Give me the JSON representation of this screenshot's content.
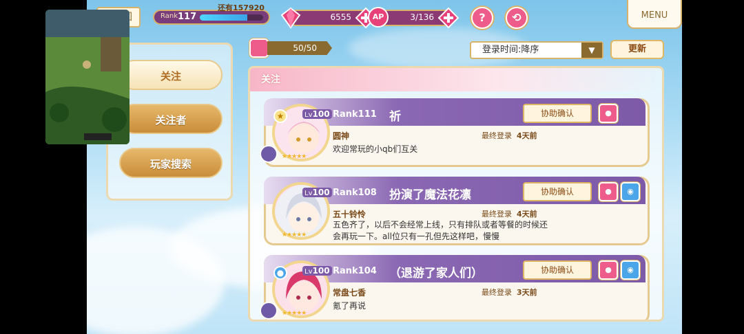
{
  "topbar": {
    "back_label": "回",
    "rank_label": "Rank",
    "rank_value": "117",
    "rank_remaining": "还有157920",
    "rank_progress": 0.75,
    "gems_value": "6555",
    "ap_label": "AP",
    "ap_value": "3/136",
    "help_label": "?",
    "menu_label": "MENU"
  },
  "sidebar": {
    "items": [
      {
        "label": "关注"
      },
      {
        "label": "关注者"
      },
      {
        "label": "玩家搜索"
      }
    ]
  },
  "toolbar": {
    "count": "50/50",
    "sort_value": "登录时间:降序",
    "refresh_label": "更新"
  },
  "list": {
    "header": "关注",
    "assist_label": "协助确认",
    "lv_prefix": "Lv",
    "last_login_prefix": "最终登录",
    "rows": [
      {
        "lv": "100",
        "rank": "Rank111",
        "player_name": "祈",
        "char_name": "圆神",
        "last_login": "4天前",
        "comment": "欢迎常玩的小qb们互关",
        "badge": "★",
        "has_blue_icon": false
      },
      {
        "lv": "100",
        "rank": "Rank108",
        "player_name": "扮演了魔法花凛",
        "char_name": "五十铃怜",
        "last_login": "4天前",
        "comment": "五色齐了，以后不会经常上线，只有排队或者等餐的时候还会再玩一下。all位只有一孔但先这样吧，慢慢",
        "badge": "",
        "has_blue_icon": true
      },
      {
        "lv": "100",
        "rank": "Rank104",
        "player_name": "（退游了家人们）",
        "char_name": "常盘七香",
        "last_login": "3天前",
        "comment": "氪了再说",
        "badge": "",
        "has_blue_icon": true
      }
    ]
  },
  "colors": {
    "accent_pink": "#ee5c8c",
    "purple_band": "#7d5aa8",
    "gold_border": "#d9b26a"
  }
}
